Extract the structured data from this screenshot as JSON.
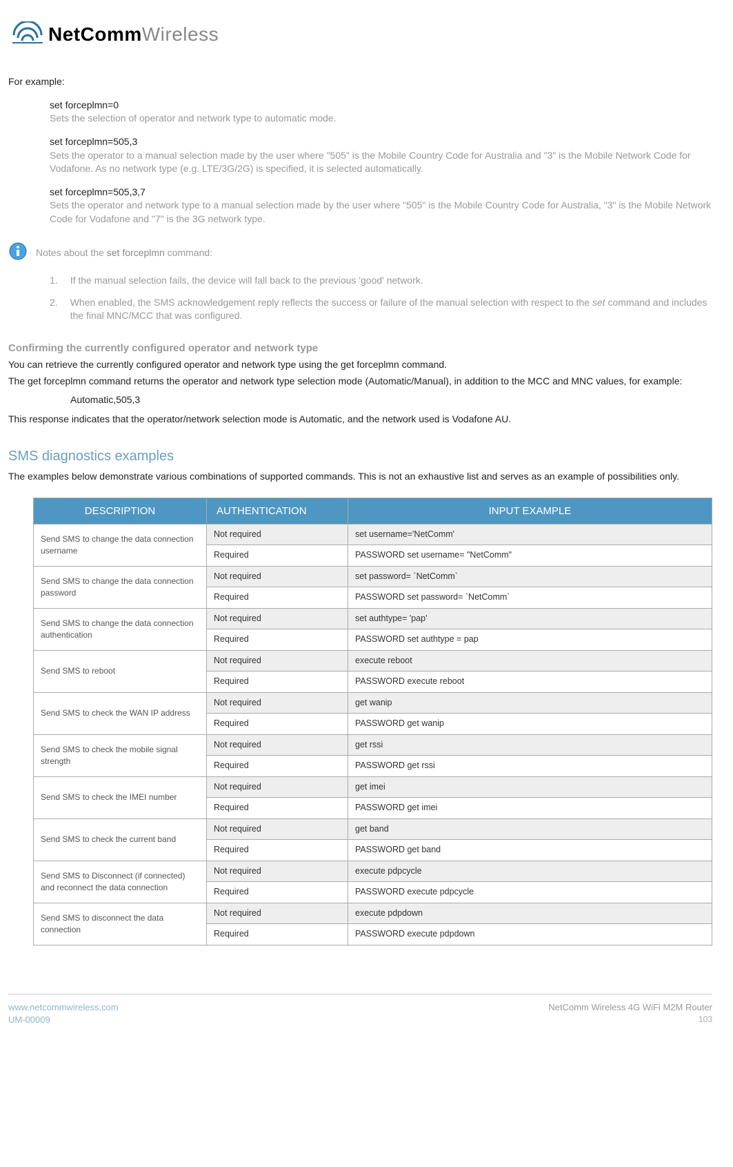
{
  "logo": {
    "bold": "NetComm",
    "light": "Wireless"
  },
  "intro": "For example:",
  "examples": [
    {
      "cmd": "set forceplmn=0",
      "desc": "Sets the selection of operator and network type to automatic mode."
    },
    {
      "cmd": "set forceplmn=505,3",
      "desc": "Sets the operator to a manual selection made by the user where \"505\" is the Mobile Country Code for Australia and \"3\" is the Mobile Network Code for Vodafone. As no network type (e.g. LTE/3G/2G) is specified, it is selected automatically."
    },
    {
      "cmd": "set forceplmn=505,3,7",
      "desc": "Sets the operator and network type to a manual selection made by the user where \"505\" is the Mobile Country Code for Australia, \"3\" is the Mobile Network Code for Vodafone and \"7\" is the 3G network type."
    }
  ],
  "notes_label_pre": "Notes about the ",
  "notes_label_cmd": "set forceplmn",
  "notes_label_post": " command:",
  "notes": [
    "If the manual selection fails, the device will fall back to the previous 'good' network.",
    "When enabled, the SMS acknowledgement reply reflects the success or failure of the manual selection with respect to the set command and includes the final MNC/MCC that was configured."
  ],
  "confirm_heading": "Confirming the currently configured operator and network type",
  "confirm_p1_pre": "You can retrieve the currently configured operator and network type using the ",
  "confirm_p1_cmd": "get forceplmn",
  "confirm_p1_post": " command.",
  "confirm_p2_pre": "The ",
  "confirm_p2_cmd": "get forceplmn",
  "confirm_p2_post": " command returns the operator and network type selection mode (Automatic/Manual), in addition to the MCC and MNC values, for example:",
  "confirm_example": "Automatic,505,3",
  "confirm_p3": "This response indicates that the operator/network selection mode is Automatic, and the network used is Vodafone AU.",
  "diag_heading": "SMS diagnostics examples",
  "diag_intro": "The examples below demonstrate various combinations of supported commands. This is not an exhaustive list and serves as an example of possibilities only.",
  "table": {
    "headers": {
      "desc": "DESCRIPTION",
      "auth": "AUTHENTICATION",
      "input": "INPUT EXAMPLE"
    },
    "rows": [
      {
        "desc": "Send SMS to change the data connection username",
        "nr_auth": "Not required",
        "nr_input": "set username='NetComm'",
        "r_auth": "Required",
        "r_input": "PASSWORD set username= \"NetComm\""
      },
      {
        "desc": "Send SMS to change the data connection password",
        "nr_auth": "Not required",
        "nr_input": "set password= `NetComm`",
        "r_auth": "Required",
        "r_input": "PASSWORD set password= `NetComm`"
      },
      {
        "desc": "Send SMS to change the data connection authentication",
        "nr_auth": "Not required",
        "nr_input": "set authtype= 'pap'",
        "r_auth": "Required",
        "r_input": "PASSWORD  set authtype = pap"
      },
      {
        "desc": "Send SMS to reboot",
        "nr_auth": "Not required",
        "nr_input": "execute reboot",
        "r_auth": "Required",
        "r_input": "PASSWORD execute reboot"
      },
      {
        "desc": "Send SMS to check the WAN IP address",
        "nr_auth": "Not required",
        "nr_input": "get wanip",
        "r_auth": "Required",
        "r_input": "PASSWORD get wanip"
      },
      {
        "desc": "Send SMS to check the mobile signal strength",
        "nr_auth": "Not required",
        "nr_input": "get rssi",
        "r_auth": "Required",
        "r_input": "PASSWORD get rssi"
      },
      {
        "desc": "Send SMS to check the IMEI number",
        "nr_auth": "Not required",
        "nr_input": "get imei",
        "r_auth": "Required",
        "r_input": "PASSWORD get imei"
      },
      {
        "desc": "Send SMS to check the current band",
        "nr_auth": "Not required",
        "nr_input": "get band",
        "r_auth": "Required",
        "r_input": "PASSWORD get band"
      },
      {
        "desc": "Send SMS to Disconnect (if connected) and reconnect the data connection",
        "nr_auth": "Not required",
        "nr_input": "execute pdpcycle",
        "r_auth": "Required",
        "r_input": "PASSWORD execute pdpcycle"
      },
      {
        "desc": "Send SMS to disconnect the data connection",
        "nr_auth": "Not required",
        "nr_input": "execute pdpdown",
        "r_auth": "Required",
        "r_input": "PASSWORD execute pdpdown"
      }
    ]
  },
  "footer": {
    "url": "www.netcommwireless.com",
    "um": "UM-00009",
    "product": "NetComm Wireless 4G WiFi M2M Router",
    "page": "103"
  }
}
